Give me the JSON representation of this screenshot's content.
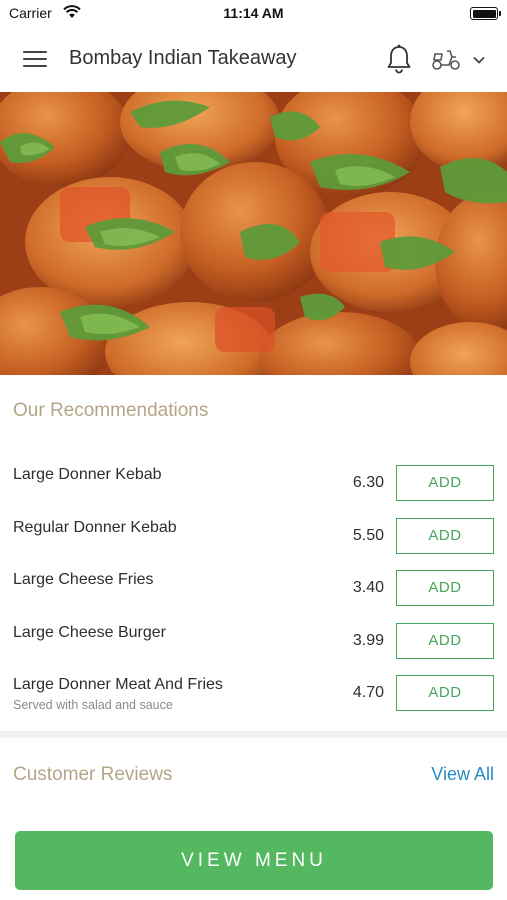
{
  "status_bar": {
    "carrier": "Carrier",
    "time": "11:14 AM",
    "icons": [
      "wifi-icon",
      "battery-icon"
    ]
  },
  "header": {
    "title": "Bombay Indian Takeaway",
    "icons": [
      "menu-icon",
      "bell-icon",
      "scooter-icon",
      "chevron-down-icon"
    ]
  },
  "hero": {
    "subject": "curry dish with coriander garnish"
  },
  "recommendations": {
    "title": "Our Recommendations",
    "add_label": "ADD",
    "items": [
      {
        "name": "Large Donner Kebab",
        "price": "6.30",
        "add": "ADD"
      },
      {
        "name": "Regular Donner Kebab",
        "price": "5.50",
        "add": "ADD"
      },
      {
        "name": "Large Cheese Fries",
        "price": "3.40",
        "add": "ADD"
      },
      {
        "name": "Large Cheese Burger",
        "price": "3.99",
        "add": "ADD"
      },
      {
        "name": "Large Donner Meat And Fries",
        "subtitle": "Served with salad and sauce",
        "price": "4.70",
        "add": "ADD"
      }
    ]
  },
  "reviews": {
    "title": "Customer Reviews",
    "view_all": "View All"
  },
  "footer": {
    "view_menu": "VIEW MENU"
  },
  "colors": {
    "accent_green": "#53b85f",
    "add_green": "#46a65a",
    "section_title": "#b4a587",
    "link_blue": "#2b8bc6"
  }
}
